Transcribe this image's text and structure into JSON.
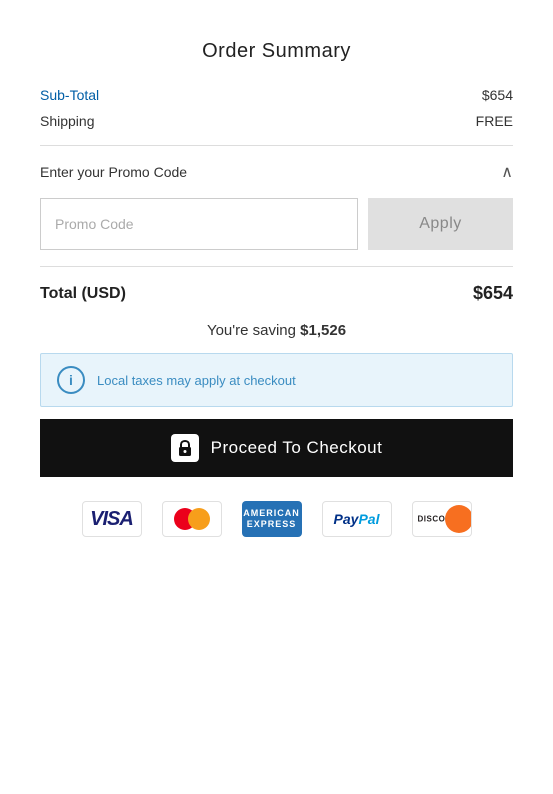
{
  "page": {
    "title": "Order Summary",
    "subtotal": {
      "label": "Sub-Total",
      "value": "$654"
    },
    "shipping": {
      "label": "Shipping",
      "value": "FREE"
    },
    "promo": {
      "header": "Enter your Promo Code",
      "placeholder": "Promo Code",
      "apply_label": "Apply"
    },
    "total": {
      "label": "Total (USD)",
      "value": "$654"
    },
    "saving": {
      "prefix": "You're saving ",
      "amount": "$1,526"
    },
    "info_banner": "Local taxes may apply at checkout",
    "checkout_button": "Proceed To Checkout",
    "payment_methods": [
      "Visa",
      "Mastercard",
      "American Express",
      "PayPal",
      "Discover"
    ]
  }
}
